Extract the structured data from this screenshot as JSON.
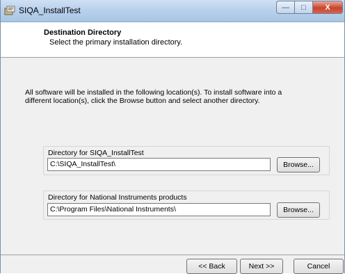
{
  "window": {
    "title": "SIQA_InstallTest",
    "icon": "installer-icon",
    "caption_buttons": {
      "minimize": "—",
      "maximize": "□",
      "close": "X"
    }
  },
  "header": {
    "title": "Destination Directory",
    "subtitle": "Select the primary installation directory."
  },
  "intro_text": "All software will be installed in the following location(s). To install software into a different location(s), click the Browse button and select another directory.",
  "groups": [
    {
      "label": "Directory for SIQA_InstallTest",
      "path": "C:\\SIQA_InstallTest\\",
      "browse_label": "Browse..."
    },
    {
      "label": "Directory for National Instruments products",
      "path": "C:\\Program Files\\National Instruments\\",
      "browse_label": "Browse..."
    }
  ],
  "footer": {
    "back_label": "<< Back",
    "next_label": "Next >>",
    "cancel_label": "Cancel"
  }
}
